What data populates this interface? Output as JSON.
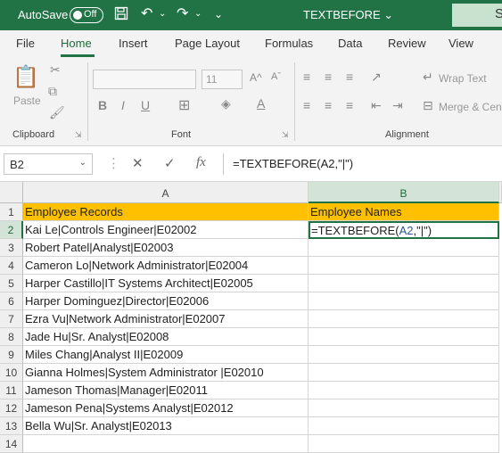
{
  "titlebar": {
    "autosave_label": "AutoSave",
    "autosave_state": "Off",
    "doc_title": "TEXTBEFORE ⌄",
    "search_label": "S"
  },
  "tabs": [
    {
      "label": "File"
    },
    {
      "label": "Home"
    },
    {
      "label": "Insert"
    },
    {
      "label": "Page Layout"
    },
    {
      "label": "Formulas"
    },
    {
      "label": "Data"
    },
    {
      "label": "Review"
    },
    {
      "label": "View"
    }
  ],
  "ribbon": {
    "paste_label": "Paste",
    "font_size": "11",
    "wrap_text_label": "Wrap Text",
    "merge_label": "Merge & Cen",
    "groups": [
      "Clipboard",
      "Font",
      "Alignment"
    ]
  },
  "formula_bar": {
    "name_box": "B2",
    "formula": "=TEXTBEFORE(A2,\"|\")"
  },
  "columns": [
    "A",
    "B"
  ],
  "rows": [
    {
      "num": "1",
      "a": "Employee Records",
      "b": "Employee Names"
    },
    {
      "num": "2",
      "a": "Kai Le|Controls Engineer|E02002",
      "b_prefix": "=TEXTBEFORE(",
      "b_ref": "A2",
      "b_suffix": ",\"|\")"
    },
    {
      "num": "3",
      "a": "Robert Patel|Analyst|E02003",
      "b": ""
    },
    {
      "num": "4",
      "a": "Cameron Lo|Network Administrator|E02004",
      "b": ""
    },
    {
      "num": "5",
      "a": "Harper Castillo|IT Systems Architect|E02005",
      "b": ""
    },
    {
      "num": "6",
      "a": "Harper Dominguez|Director|E02006",
      "b": ""
    },
    {
      "num": "7",
      "a": "Ezra Vu|Network Administrator|E02007",
      "b": ""
    },
    {
      "num": "8",
      "a": "Jade Hu|Sr. Analyst|E02008",
      "b": ""
    },
    {
      "num": "9",
      "a": "Miles Chang|Analyst II|E02009",
      "b": ""
    },
    {
      "num": "10",
      "a": "Gianna Holmes|System Administrator |E02010",
      "b": ""
    },
    {
      "num": "11",
      "a": "Jameson Thomas|Manager|E02011",
      "b": ""
    },
    {
      "num": "12",
      "a": "Jameson Pena|Systems Analyst|E02012",
      "b": ""
    },
    {
      "num": "13",
      "a": "Bella Wu|Sr. Analyst|E02013",
      "b": ""
    },
    {
      "num": "14",
      "a": "",
      "b": ""
    }
  ],
  "colors": {
    "excel_green": "#217346",
    "header_fill": "#ffc000",
    "ref_blue": "#2b5797"
  }
}
